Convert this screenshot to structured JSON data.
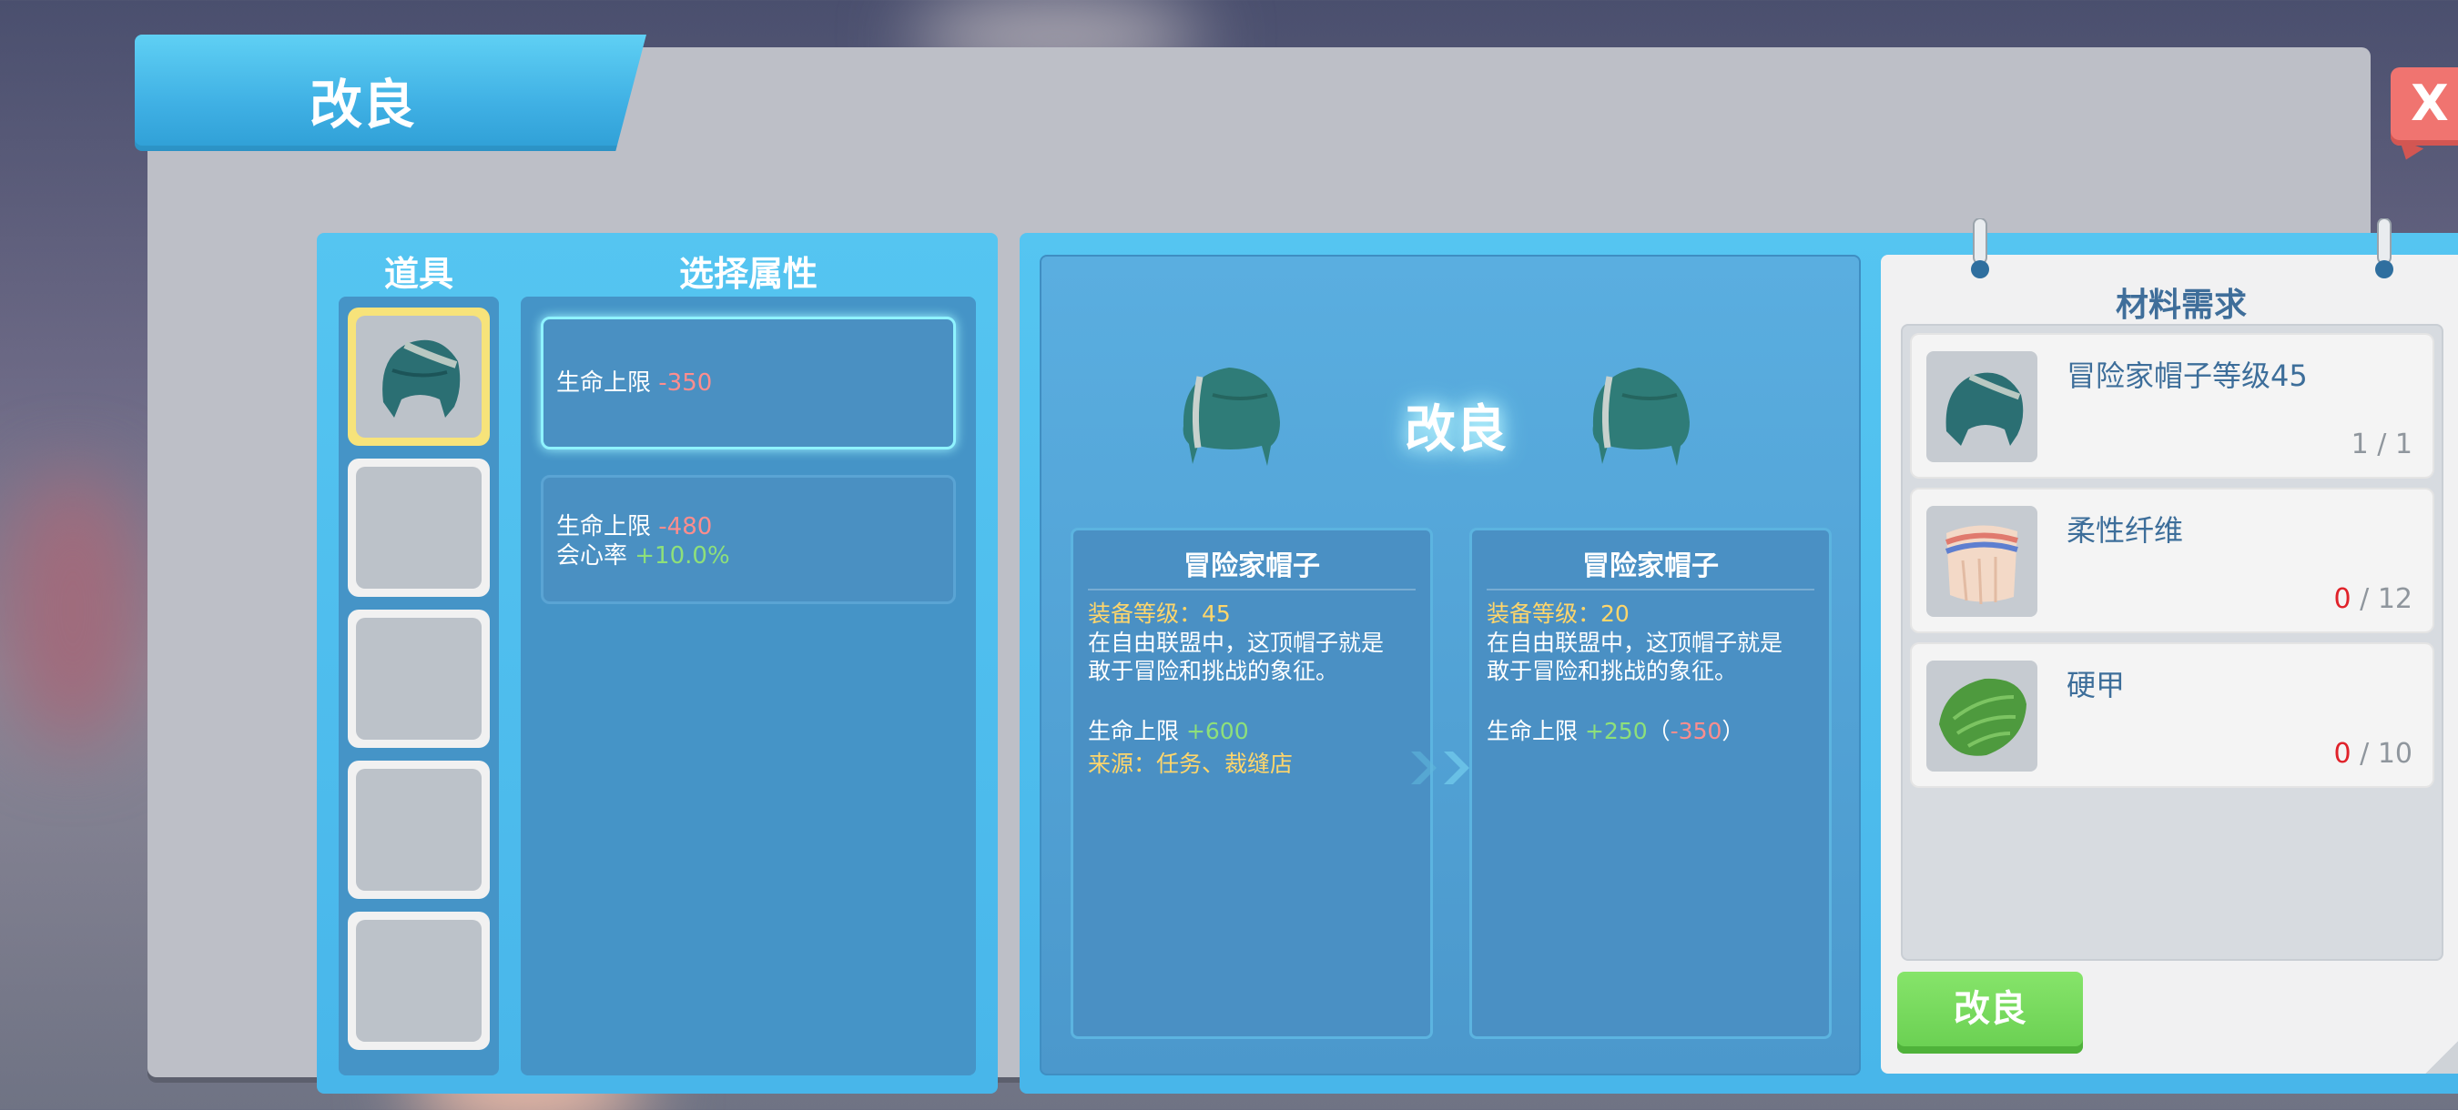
{
  "window": {
    "title": "改良",
    "close_label": "X"
  },
  "left": {
    "items_header": "道具",
    "attrs_header": "选择属性",
    "attributes": [
      {
        "lines": [
          {
            "label": "生命上限 ",
            "value": "-350"
          }
        ]
      },
      {
        "lines": [
          {
            "label": "生命上限 ",
            "value": "-480"
          },
          {
            "label": "会心率 ",
            "value": "+10.0%"
          }
        ]
      }
    ]
  },
  "preview": {
    "center_label": "改良",
    "current": {
      "name": "冒险家帽子",
      "level_label": "装备等级：",
      "level": "45",
      "desc_line1": "在自由联盟中，这顶帽子就是",
      "desc_line2": "敢于冒险和挑战的象征。",
      "stat_label": "生命上限 ",
      "stat_value": "+600",
      "source": "来源：任务、裁缝店"
    },
    "result": {
      "name": "冒险家帽子",
      "level_label": "装备等级：",
      "level": "20",
      "desc_line1": "在自由联盟中，这顶帽子就是",
      "desc_line2": "敢于冒险和挑战的象征。",
      "stat_label": "生命上限 ",
      "stat_value": "+250",
      "paren_open": "（",
      "stat_delta": "-350",
      "paren_close": "）"
    }
  },
  "materials": {
    "title": "材料需求",
    "items": [
      {
        "name": "冒险家帽子等级45",
        "have": "1",
        "sep": " / ",
        "need": "1",
        "icon": "hat-icon"
      },
      {
        "name": "柔性纤维",
        "have": "0",
        "sep": " / ",
        "need": "12",
        "icon": "fiber-icon"
      },
      {
        "name": "硬甲",
        "have": "0",
        "sep": " / ",
        "need": "10",
        "icon": "hard-shell-icon"
      }
    ],
    "button_label": "改良"
  },
  "colors": {
    "panel_blue": "#48b6ea",
    "accent_green": "#69cf51",
    "close_red": "#f07470",
    "negative": "#ff8d8d",
    "positive": "#8ee07a",
    "level_yellow": "#ffd66b",
    "short_red": "#e0222a"
  }
}
